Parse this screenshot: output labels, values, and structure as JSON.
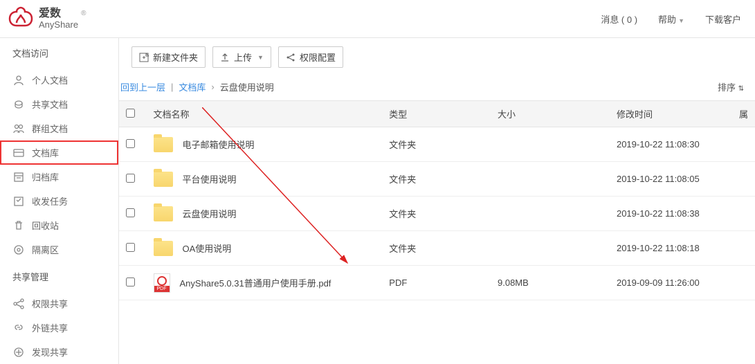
{
  "header": {
    "brand_cn": "爱数",
    "brand_en": "AnyShare",
    "messages_label": "消息 ( 0 )",
    "help_label": "帮助",
    "download_label": "下载客户"
  },
  "sidebar": {
    "section1_title": "文档访问",
    "items1": [
      {
        "label": "个人文档",
        "icon": "person"
      },
      {
        "label": "共享文档",
        "icon": "share-doc"
      },
      {
        "label": "群组文档",
        "icon": "group"
      },
      {
        "label": "文档库",
        "icon": "archive",
        "highlighted": true
      },
      {
        "label": "归档库",
        "icon": "box"
      },
      {
        "label": "收发任务",
        "icon": "task"
      },
      {
        "label": "回收站",
        "icon": "trash"
      },
      {
        "label": "隔离区",
        "icon": "quarantine"
      }
    ],
    "section2_title": "共享管理",
    "items2": [
      {
        "label": "权限共享",
        "icon": "share"
      },
      {
        "label": "外链共享",
        "icon": "link"
      },
      {
        "label": "发现共享",
        "icon": "discover"
      }
    ]
  },
  "toolbar": {
    "new_folder": "新建文件夹",
    "upload": "上传",
    "perm": "权限配置"
  },
  "breadcrumb": {
    "back": "回到上一层",
    "sep": "|",
    "lib": "文档库",
    "current": "云盘使用说明",
    "sort": "排序"
  },
  "table": {
    "headers": {
      "name": "文档名称",
      "type": "类型",
      "size": "大小",
      "mtime": "修改时间",
      "last": "属"
    },
    "rows": [
      {
        "name": "电子邮箱使用说明",
        "type": "文件夹",
        "size": "",
        "mtime": "2019-10-22 11:08:30",
        "kind": "folder"
      },
      {
        "name": "平台使用说明",
        "type": "文件夹",
        "size": "",
        "mtime": "2019-10-22 11:08:05",
        "kind": "folder"
      },
      {
        "name": "云盘使用说明",
        "type": "文件夹",
        "size": "",
        "mtime": "2019-10-22 11:08:38",
        "kind": "folder"
      },
      {
        "name": "OA使用说明",
        "type": "文件夹",
        "size": "",
        "mtime": "2019-10-22 11:08:18",
        "kind": "folder"
      },
      {
        "name": "AnyShare5.0.31普通用户使用手册.pdf",
        "type": "PDF",
        "size": "9.08MB",
        "mtime": "2019-09-09 11:26:00",
        "kind": "pdf"
      }
    ]
  }
}
